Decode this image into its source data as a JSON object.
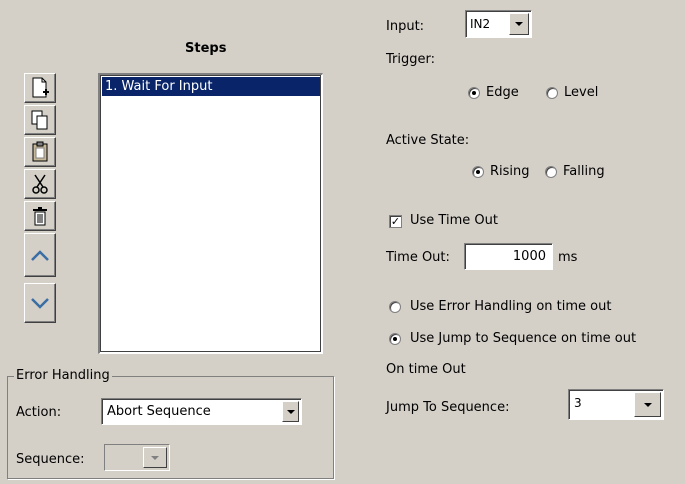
{
  "steps": {
    "title": "Steps",
    "items": [
      "1. Wait For Input"
    ]
  },
  "toolbar_icons": [
    "new-step-icon",
    "copy-icon",
    "paste-icon",
    "cut-icon",
    "delete-icon",
    "move-up-icon",
    "move-down-icon"
  ],
  "error_handling": {
    "legend": "Error Handling",
    "action_label": "Action:",
    "action_value": "Abort Sequence",
    "sequence_label": "Sequence:",
    "sequence_value": ""
  },
  "input": {
    "label": "Input:",
    "value": "IN2"
  },
  "trigger": {
    "label": "Trigger:",
    "options": [
      "Edge",
      "Level"
    ],
    "selected": "Edge"
  },
  "active_state": {
    "label": "Active State:",
    "options": [
      "Rising",
      "Falling"
    ],
    "selected": "Rising"
  },
  "timeout": {
    "use_label": "Use Time Out",
    "use_checked": true,
    "label": "Time Out:",
    "value": "1000",
    "unit": "ms"
  },
  "on_timeout": {
    "error_option": "Use Error Handling on time out",
    "jump_option": "Use Jump to Sequence on time out",
    "selected": "jump",
    "section_label": "On time Out",
    "jump_label": "Jump To Sequence:",
    "jump_value": "3"
  }
}
